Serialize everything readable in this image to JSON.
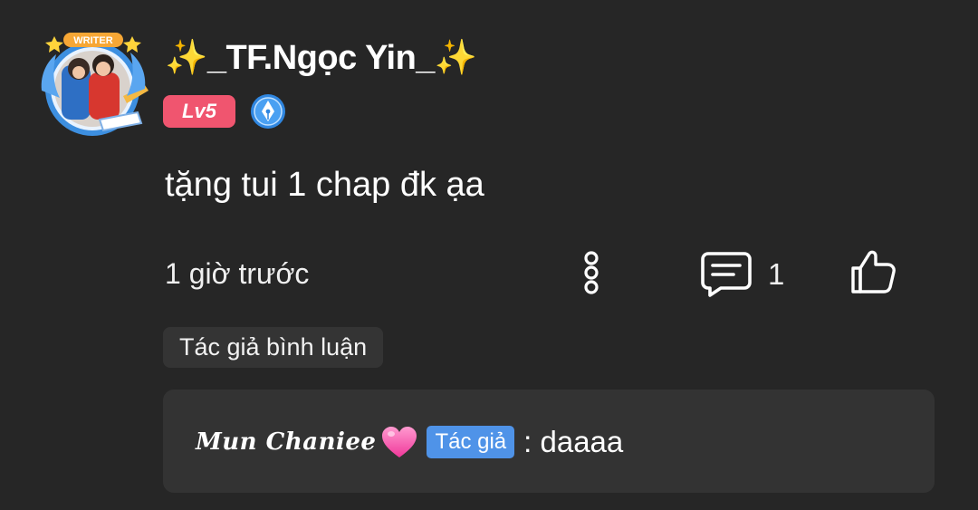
{
  "comment": {
    "user": {
      "name": "✨_TF.Ngọc Yin_✨",
      "avatar_frame_label": "WRITER",
      "level": "Lv5",
      "badge_icon": "writer-pen-badge-icon"
    },
    "text": "tặng tui 1 chap đk ạa",
    "timestamp": "1 giờ trước",
    "reply_count": "1",
    "icons": {
      "more": "more-vertical-icon",
      "reply": "reply-comment-icon",
      "like": "thumbs-up-icon"
    },
    "author_reply_tag": "Tác giả bình luận",
    "reply": {
      "author": "Mun Chaniee",
      "author_emoji": "💗",
      "role_chip": "Tác giả",
      "text": ": daaaa"
    }
  },
  "colors": {
    "background": "#262626",
    "level_badge": "#f0556f",
    "author_chip": "#4f93e8",
    "writer_badge": "#2f86e0"
  }
}
